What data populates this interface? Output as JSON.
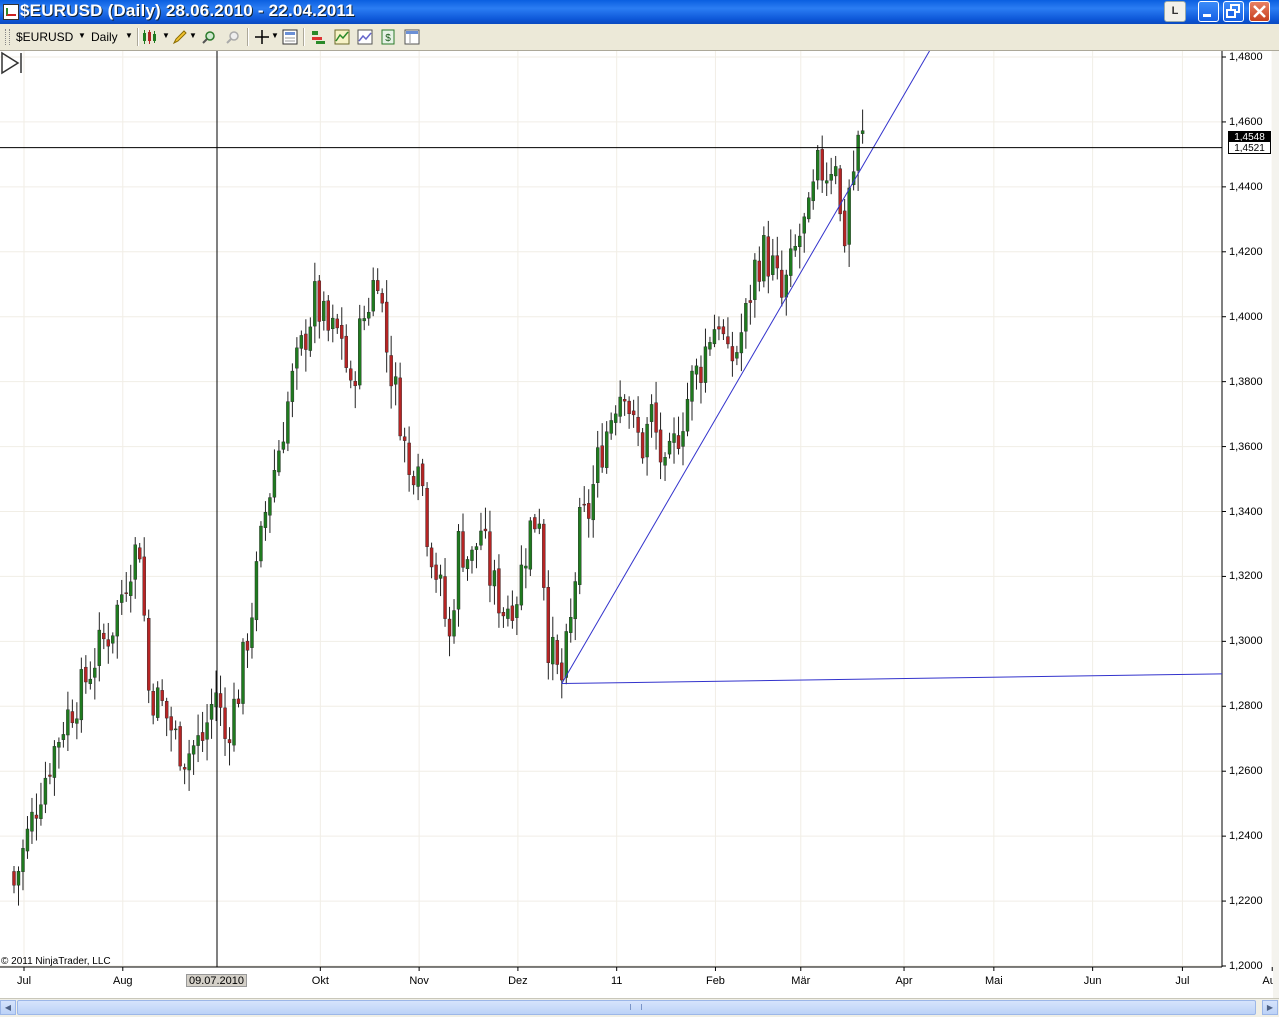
{
  "window": {
    "title": "$EURUSD (Daily)  28.06.2010 - 22.04.2011",
    "link_button_label": "L"
  },
  "toolbar": {
    "instrument": "$EURUSD",
    "period": "Daily",
    "icons": [
      "chart-style-icon",
      "drawing-tools-icon",
      "zoom-in-icon",
      "zoom-out-icon",
      "crosshair-icon",
      "data-box-icon",
      "strategies-icon",
      "indicators-icon",
      "chart-trader-icon",
      "orders-icon",
      "properties-icon"
    ]
  },
  "chart": {
    "copyright": "© 2011 NinjaTrader, LLC",
    "crosshair_date": "09.07.2010",
    "last_price_tag": "1,4548",
    "crosshair_price_tag": "1,4521",
    "colors": {
      "up_candle": "#1f7a1f",
      "down_candle": "#b52424",
      "trendline": "#3333cc",
      "crosshair": "#000000"
    }
  },
  "chart_data": {
    "type": "candlestick",
    "instrument": "$EURUSD",
    "period": "Daily",
    "x_tick_labels": [
      "Jul",
      "Aug",
      "Okt",
      "Nov",
      "Dez",
      "11",
      "Feb",
      "Mär",
      "Apr",
      "Mai",
      "Jun",
      "Jul",
      "Aug"
    ],
    "y_tick_labels": [
      "1,4800",
      "1,4600",
      "1,4400",
      "1,4200",
      "1,4000",
      "1,3800",
      "1,3600",
      "1,3400",
      "1,3200",
      "1,3000",
      "1,2800",
      "1,2600",
      "1,2400",
      "1,2200",
      "1,2000"
    ],
    "ylim": [
      1.2,
      1.48
    ],
    "grid": true,
    "close_path": [
      [
        0,
        1.225
      ],
      [
        6,
        1.255
      ],
      [
        11,
        1.275
      ],
      [
        15,
        1.285
      ],
      [
        18,
        1.295
      ],
      [
        22,
        1.305
      ],
      [
        26,
        1.325
      ],
      [
        28,
        1.33
      ],
      [
        30,
        1.285
      ],
      [
        33,
        1.28
      ],
      [
        36,
        1.27
      ],
      [
        38,
        1.265
      ],
      [
        42,
        1.27
      ],
      [
        45,
        1.285
      ],
      [
        47,
        1.27
      ],
      [
        50,
        1.285
      ],
      [
        53,
        1.31
      ],
      [
        56,
        1.34
      ],
      [
        59,
        1.36
      ],
      [
        62,
        1.38
      ],
      [
        65,
        1.395
      ],
      [
        67,
        1.405
      ],
      [
        70,
        1.395
      ],
      [
        73,
        1.395
      ],
      [
        75,
        1.375
      ],
      [
        77,
        1.395
      ],
      [
        79,
        1.405
      ],
      [
        81,
        1.415
      ],
      [
        83,
        1.39
      ],
      [
        86,
        1.37
      ],
      [
        88,
        1.35
      ],
      [
        90,
        1.36
      ],
      [
        92,
        1.335
      ],
      [
        95,
        1.315
      ],
      [
        97,
        1.3
      ],
      [
        99,
        1.33
      ],
      [
        102,
        1.325
      ],
      [
        104,
        1.335
      ],
      [
        106,
        1.32
      ],
      [
        109,
        1.31
      ],
      [
        112,
        1.315
      ],
      [
        115,
        1.335
      ],
      [
        117,
        1.34
      ],
      [
        119,
        1.3
      ],
      [
        121,
        1.29
      ],
      [
        122,
        1.288
      ],
      [
        124,
        1.305
      ],
      [
        126,
        1.335
      ],
      [
        128,
        1.34
      ],
      [
        130,
        1.355
      ],
      [
        132,
        1.365
      ],
      [
        134,
        1.375
      ],
      [
        136,
        1.38
      ],
      [
        138,
        1.365
      ],
      [
        140,
        1.36
      ],
      [
        142,
        1.37
      ],
      [
        145,
        1.35
      ],
      [
        147,
        1.36
      ],
      [
        149,
        1.37
      ],
      [
        151,
        1.38
      ],
      [
        153,
        1.385
      ],
      [
        155,
        1.395
      ],
      [
        157,
        1.4
      ],
      [
        159,
        1.385
      ],
      [
        161,
        1.39
      ],
      [
        163,
        1.4
      ],
      [
        165,
        1.415
      ],
      [
        167,
        1.42
      ],
      [
        169,
        1.415
      ],
      [
        171,
        1.405
      ],
      [
        173,
        1.415
      ],
      [
        175,
        1.425
      ],
      [
        177,
        1.43
      ],
      [
        179,
        1.445
      ],
      [
        181,
        1.445
      ],
      [
        183,
        1.45
      ],
      [
        184,
        1.43
      ],
      [
        185,
        1.425
      ],
      [
        186,
        1.44
      ],
      [
        187,
        1.445
      ],
      [
        188,
        1.453
      ],
      [
        189,
        1.4548
      ]
    ],
    "bar_count": 190,
    "trendline_rising": {
      "from": [
        "2011-01-10",
        1.287
      ],
      "through": [
        "2011-04-15",
        1.425
      ]
    },
    "trendline_flat": {
      "from": [
        "2011-01-10",
        1.287
      ],
      "to_price_at_right_edge": 1.29
    },
    "last_price": "1,4548",
    "crosshair_price": "1,4521"
  }
}
